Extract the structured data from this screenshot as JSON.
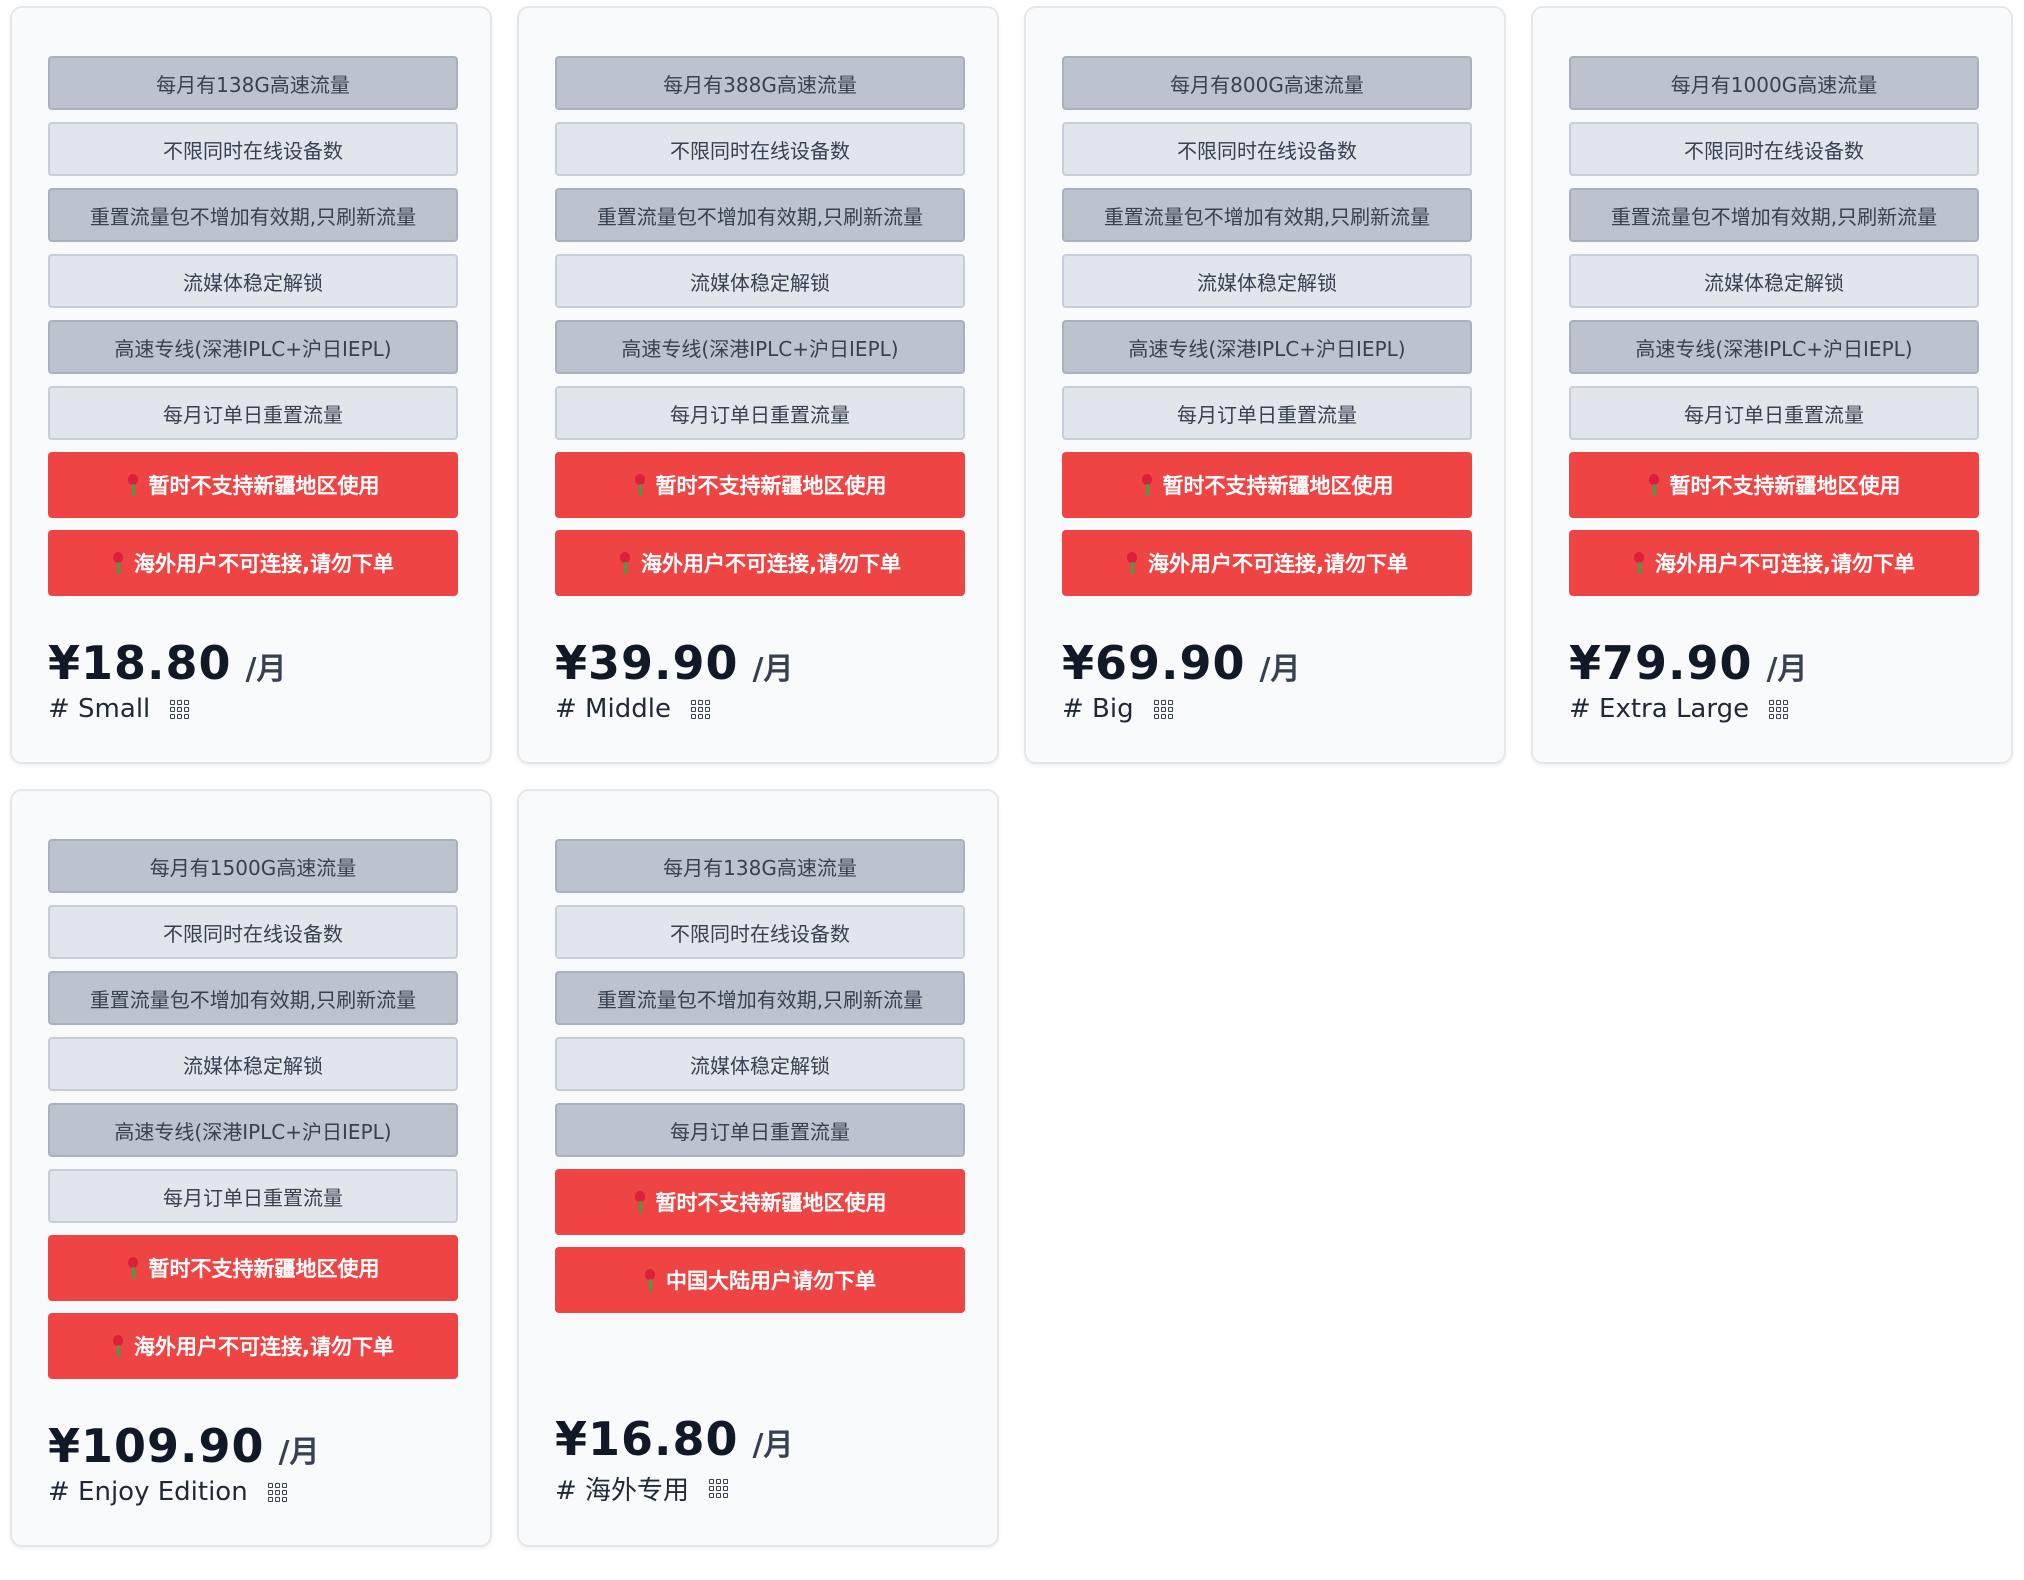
{
  "currency_symbol": "¥",
  "plans": [
    {
      "features": [
        "每月有138G高速流量",
        "不限同时在线设备数",
        "重置流量包不增加有效期,只刷新流量",
        "流媒体稳定解锁",
        "高速专线(深港IPLC+沪日IEPL)",
        "每月订单日重置流量"
      ],
      "warnings": [
        "暂时不支持新疆地区使用",
        "海外用户不可连接,请勿下单"
      ],
      "price": "¥18.80",
      "unit": "/月",
      "name": "# Small"
    },
    {
      "features": [
        "每月有388G高速流量",
        "不限同时在线设备数",
        "重置流量包不增加有效期,只刷新流量",
        "流媒体稳定解锁",
        "高速专线(深港IPLC+沪日IEPL)",
        "每月订单日重置流量"
      ],
      "warnings": [
        "暂时不支持新疆地区使用",
        "海外用户不可连接,请勿下单"
      ],
      "price": "¥39.90",
      "unit": "/月",
      "name": "# Middle"
    },
    {
      "features": [
        "每月有800G高速流量",
        "不限同时在线设备数",
        "重置流量包不增加有效期,只刷新流量",
        "流媒体稳定解锁",
        "高速专线(深港IPLC+沪日IEPL)",
        "每月订单日重置流量"
      ],
      "warnings": [
        "暂时不支持新疆地区使用",
        "海外用户不可连接,请勿下单"
      ],
      "price": "¥69.90",
      "unit": "/月",
      "name": "# Big"
    },
    {
      "features": [
        "每月有1000G高速流量",
        "不限同时在线设备数",
        "重置流量包不增加有效期,只刷新流量",
        "流媒体稳定解锁",
        "高速专线(深港IPLC+沪日IEPL)",
        "每月订单日重置流量"
      ],
      "warnings": [
        "暂时不支持新疆地区使用",
        "海外用户不可连接,请勿下单"
      ],
      "price": "¥79.90",
      "unit": "/月",
      "name": "# Extra Large"
    },
    {
      "features": [
        "每月有1500G高速流量",
        "不限同时在线设备数",
        "重置流量包不增加有效期,只刷新流量",
        "流媒体稳定解锁",
        "高速专线(深港IPLC+沪日IEPL)",
        "每月订单日重置流量"
      ],
      "warnings": [
        "暂时不支持新疆地区使用",
        "海外用户不可连接,请勿下单"
      ],
      "price": "¥109.90",
      "unit": "/月",
      "name": "# Enjoy Edition"
    },
    {
      "features": [
        "每月有138G高速流量",
        "不限同时在线设备数",
        "重置流量包不增加有效期,只刷新流量",
        "流媒体稳定解锁",
        "每月订单日重置流量"
      ],
      "warnings": [
        "暂时不支持新疆地区使用",
        "中国大陆用户请勿下单"
      ],
      "price": "¥16.80",
      "unit": "/月",
      "name": "# 海外专用"
    }
  ],
  "icons": {
    "warning_icon": "rose-icon",
    "plan_icon": "qr-code-icon"
  },
  "colors": {
    "warning_bg": "#ef4444",
    "feature_dark_bg": "#bcc3ce",
    "feature_light_bg": "#e1e5ec",
    "card_bg": "#f9fafb"
  }
}
